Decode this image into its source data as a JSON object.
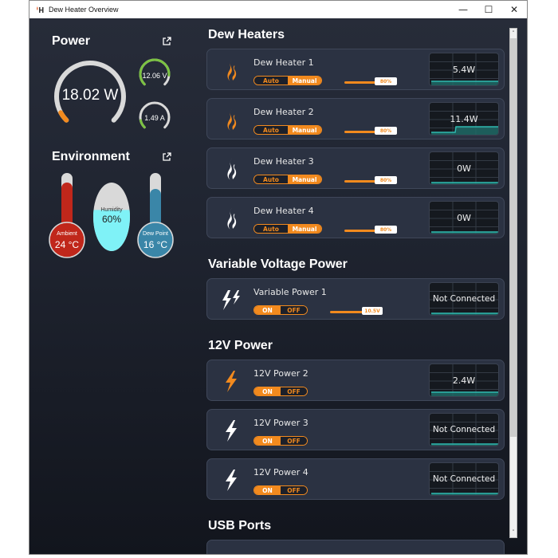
{
  "window": {
    "title": "Dew Heater Overview",
    "controls": {
      "minimize": "—",
      "maximize": "☐",
      "close": "✕"
    }
  },
  "sidebar": {
    "power": {
      "title": "Power",
      "total": {
        "label": "18.02 W",
        "fraction": 0.06
      },
      "voltage": {
        "label": "12.06 V",
        "fraction": 0.85
      },
      "current": {
        "label": "1.49 A",
        "fraction": 0.12
      }
    },
    "environment": {
      "title": "Environment",
      "ambient": {
        "label": "Ambient",
        "value": "24 °C",
        "fraction": 0.85
      },
      "humidity": {
        "label": "Humidity",
        "value": "60%",
        "fraction": 0.6
      },
      "dew_point": {
        "label": "Dew Point",
        "value": "16 °C",
        "fraction": 0.75
      }
    }
  },
  "sections": {
    "dew_heaters": {
      "title": "Dew Heaters",
      "items": [
        {
          "name": "Dew Heater 1",
          "mode_auto": "Auto",
          "mode_manual": "Manual",
          "slider": "80%",
          "slider_fraction": 0.8,
          "reading": "5.4W",
          "active": true
        },
        {
          "name": "Dew Heater 2",
          "mode_auto": "Auto",
          "mode_manual": "Manual",
          "slider": "80%",
          "slider_fraction": 0.8,
          "reading": "11.4W",
          "active": true
        },
        {
          "name": "Dew Heater 3",
          "mode_auto": "Auto",
          "mode_manual": "Manual",
          "slider": "80%",
          "slider_fraction": 0.8,
          "reading": "0W",
          "active": false
        },
        {
          "name": "Dew Heater 4",
          "mode_auto": "Auto",
          "mode_manual": "Manual",
          "slider": "80%",
          "slider_fraction": 0.8,
          "reading": "0W",
          "active": false
        }
      ]
    },
    "variable_voltage": {
      "title": "Variable Voltage Power",
      "items": [
        {
          "name": "Variable Power 1",
          "on": "ON",
          "off": "OFF",
          "slider": "10.5V",
          "reading": "Not Connected"
        }
      ]
    },
    "power_12v": {
      "title": "12V Power",
      "items": [
        {
          "name": "12V Power 2",
          "on": "ON",
          "off": "OFF",
          "reading": "2.4W",
          "active": true
        },
        {
          "name": "12V Power 3",
          "on": "ON",
          "off": "OFF",
          "reading": "Not Connected",
          "active": false
        },
        {
          "name": "12V Power 4",
          "on": "ON",
          "off": "OFF",
          "reading": "Not Connected",
          "active": false
        }
      ]
    },
    "usb": {
      "title": "USB Ports"
    }
  },
  "scrollbar": {
    "up": "˄",
    "down": "˅"
  },
  "colors": {
    "accent": "#f28a1e",
    "gauge_green": "#7cc242",
    "gauge_track": "#d9d9d9",
    "chart_line": "#2fb9b0",
    "ambient": "#c0271b",
    "humidity": "#7ff2f7",
    "dew_point": "#3a86a8"
  }
}
